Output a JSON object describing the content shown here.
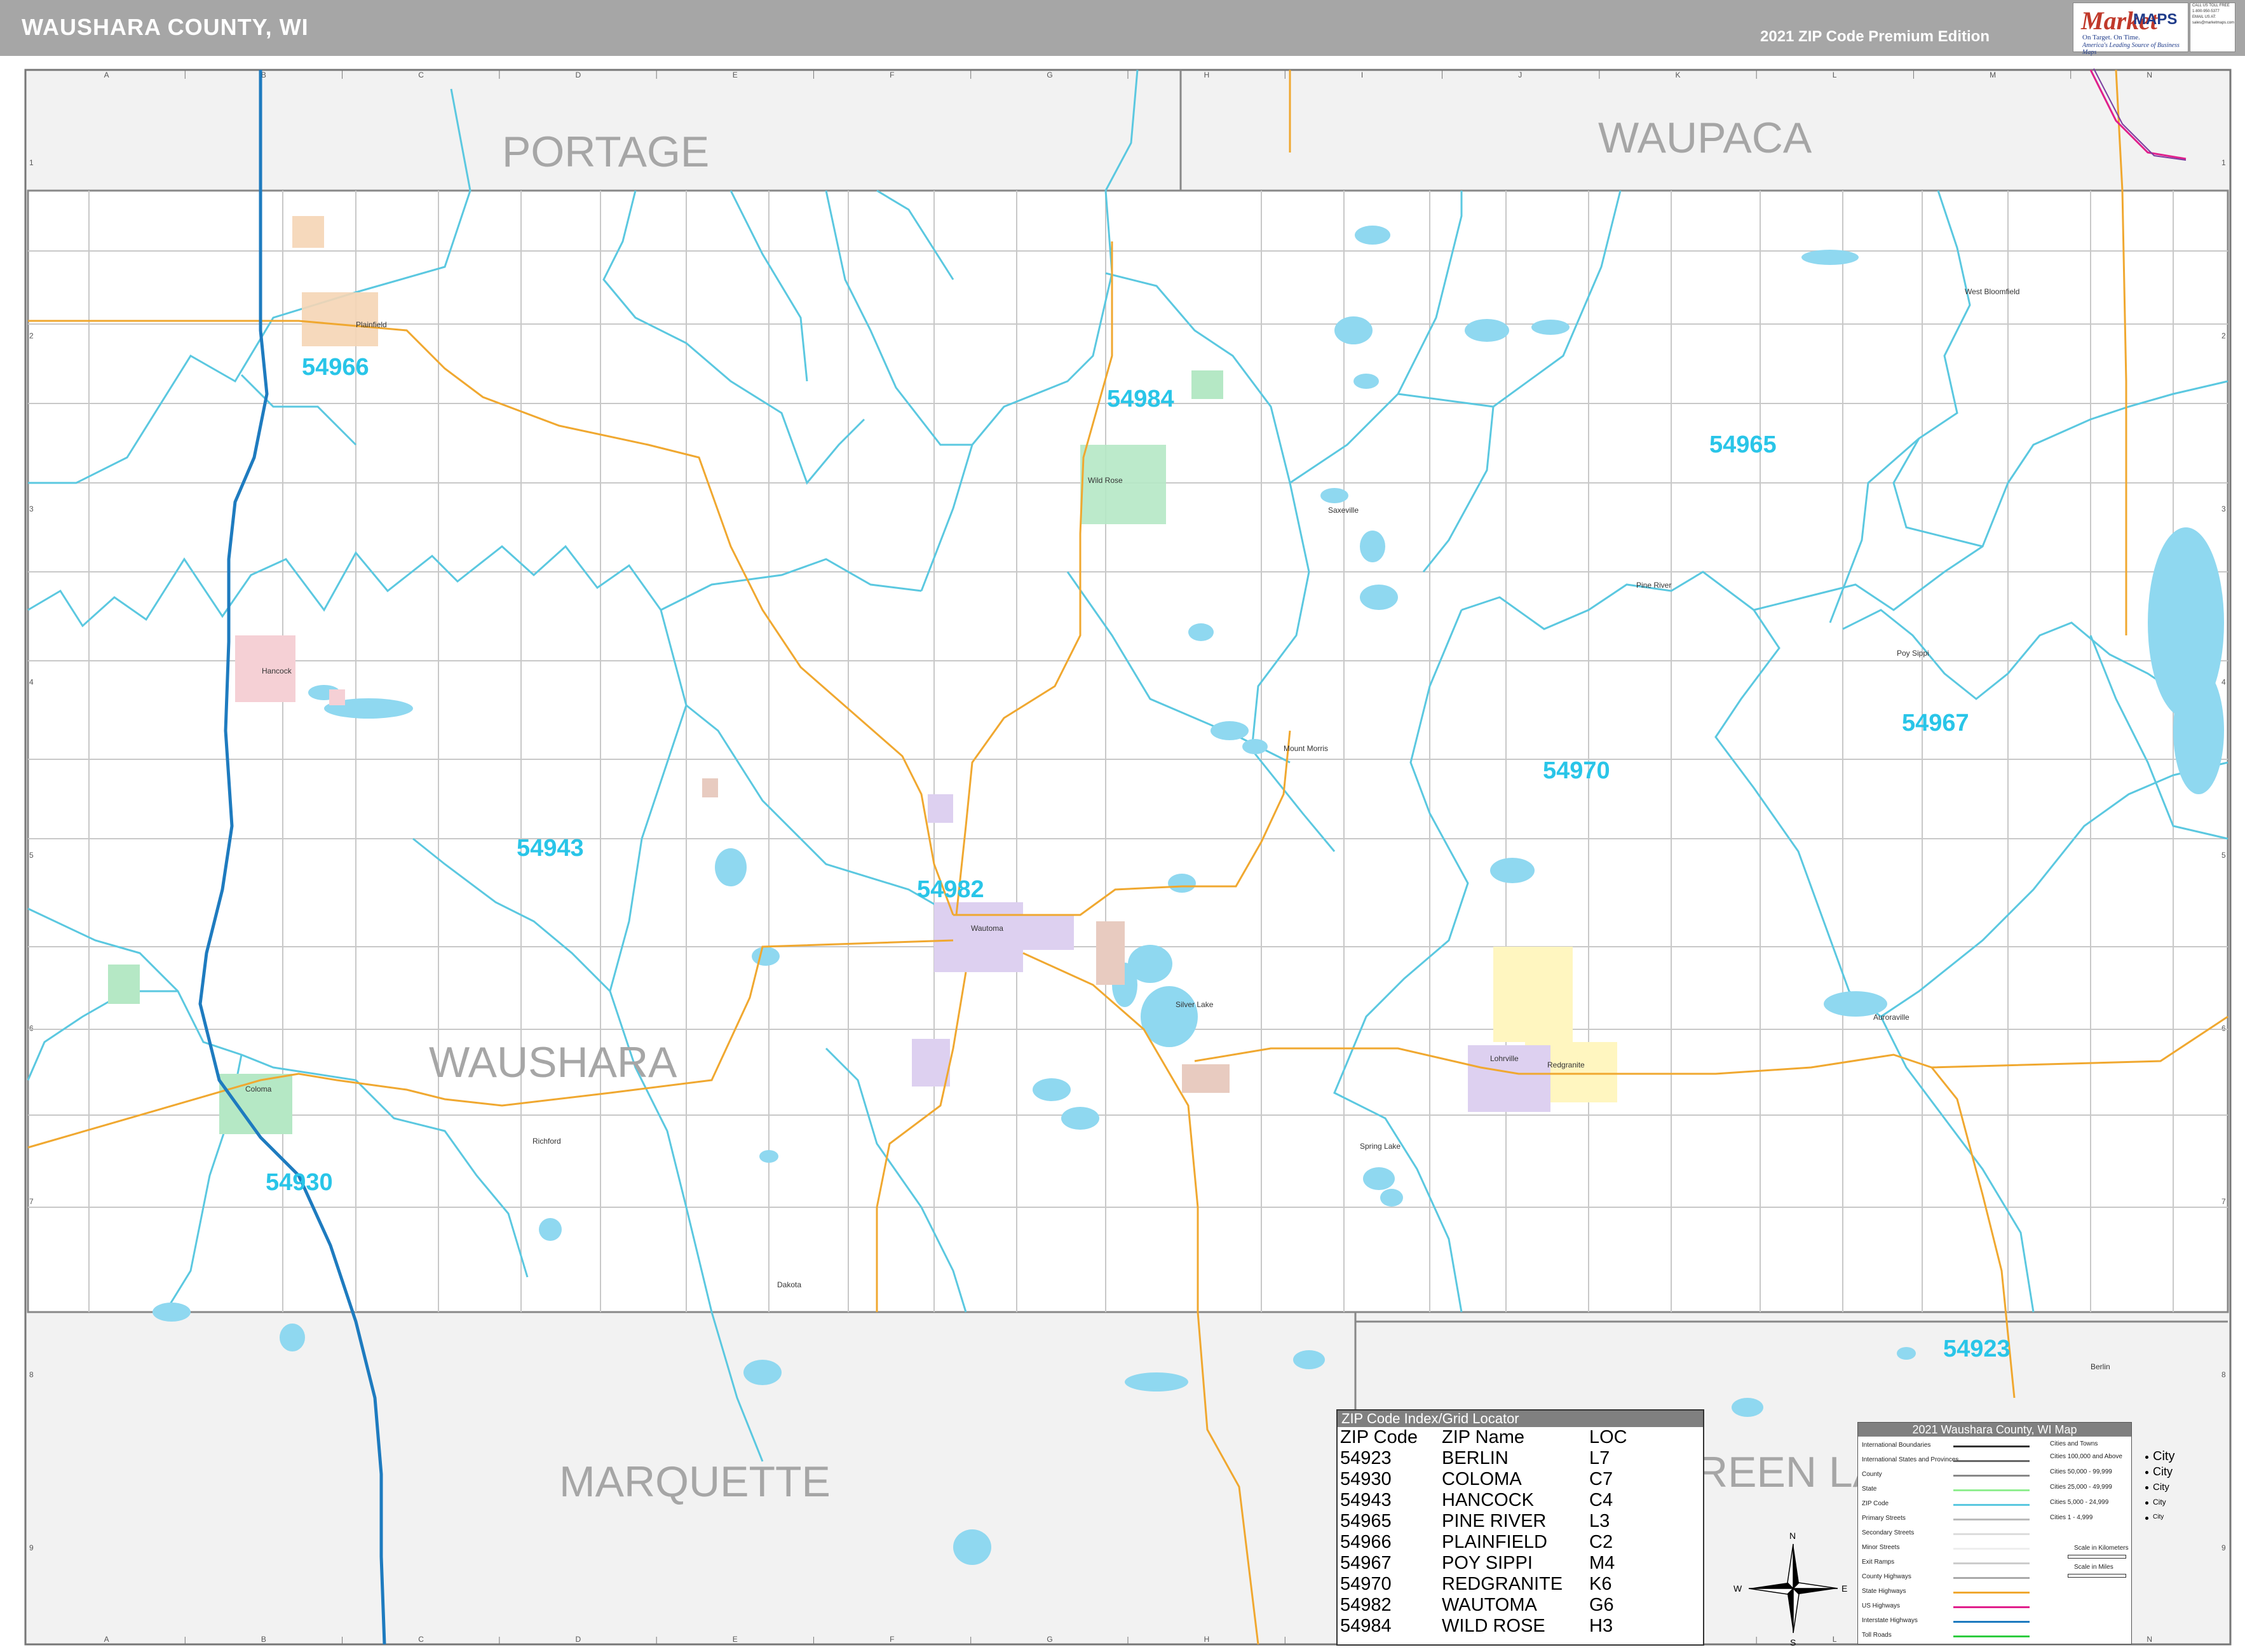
{
  "header": {
    "title": "WAUSHARA COUNTY, WI",
    "edition": "2021 ZIP Code Premium Edition"
  },
  "logo": {
    "brand": "Market",
    "maps": "MAPS",
    "tagline": "On Target.  On Time.",
    "subtag": "America's Leading Source of Business Maps"
  },
  "contact": [
    "CALL US TOLL FREE",
    "1-800-950-5377",
    "EMAIL US AT:",
    "sales@marketmaps.com"
  ],
  "grid": {
    "columns": [
      "A",
      "B",
      "C",
      "D",
      "E",
      "F",
      "G",
      "H",
      "I",
      "J",
      "K",
      "L",
      "M",
      "N"
    ],
    "rows": [
      "1",
      "2",
      "3",
      "4",
      "5",
      "6",
      "7",
      "8",
      "9"
    ]
  },
  "counties": {
    "portage": "PORTAGE",
    "waupaca": "WAUPACA",
    "waushara": "WAUSHARA",
    "marquette": "MARQUETTE",
    "green_lake": "REEN LA"
  },
  "zip_labels": {
    "z54966": "54966",
    "z54984": "54984",
    "z54965": "54965",
    "z54967": "54967",
    "z54970": "54970",
    "z54943": "54943",
    "z54982": "54982",
    "z54930": "54930",
    "z54923": "54923"
  },
  "places": {
    "plainfield": "Plainfield",
    "hancock": "Hancock",
    "wild_rose": "Wild Rose",
    "wautoma": "Wautoma",
    "coloma": "Coloma",
    "redgranite": "Redgranite",
    "lohrville": "Lohrville",
    "pine_river": "Pine River",
    "poy_sippi": "Poy Sippi",
    "mount_morris": "Mount Morris",
    "silver_lake": "Silver Lake",
    "spring_lake": "Spring Lake",
    "richford": "Richford",
    "auroraville": "Auroraville",
    "west_bloomfield": "West Bloomfield",
    "saxeville": "Saxeville",
    "dakota": "Dakota",
    "berlin": "Berlin"
  },
  "index": {
    "title": "ZIP Code Index/Grid Locator",
    "headers": [
      "ZIP Code",
      "ZIP Name",
      "LOC"
    ],
    "rows": [
      [
        "54923",
        "BERLIN",
        "L7"
      ],
      [
        "54930",
        "COLOMA",
        "C7"
      ],
      [
        "54943",
        "HANCOCK",
        "C4"
      ],
      [
        "54965",
        "PINE RIVER",
        "L3"
      ],
      [
        "54966",
        "PLAINFIELD",
        "C2"
      ],
      [
        "54967",
        "POY SIPPI",
        "M4"
      ],
      [
        "54970",
        "REDGRANITE",
        "K6"
      ],
      [
        "54982",
        "WAUTOMA",
        "G6"
      ],
      [
        "54984",
        "WILD ROSE",
        "H3"
      ]
    ]
  },
  "legend": {
    "title": "2021 Waushara County, WI Map",
    "cities_title": "Cities and Towns",
    "items": [
      {
        "label": "International Boundaries",
        "color": "#333333"
      },
      {
        "label": "International States and Provinces",
        "color": "#666666"
      },
      {
        "label": "County",
        "color": "#888888"
      },
      {
        "label": "State",
        "color": "#90ee90"
      },
      {
        "label": "ZIP Code",
        "color": "#5bc8e0"
      },
      {
        "label": "Primary Streets",
        "color": "#bbbbbb"
      },
      {
        "label": "Secondary Streets",
        "color": "#dddddd"
      },
      {
        "label": "Minor Streets",
        "color": "#eeeeee"
      },
      {
        "label": "Exit Ramps",
        "color": "#cccccc"
      },
      {
        "label": "County Highways",
        "color": "#aaaaaa"
      },
      {
        "label": "State Highways",
        "color": "#f0a830"
      },
      {
        "label": "US Highways",
        "color": "#e0208c"
      },
      {
        "label": "Interstate Highways",
        "color": "#1e7bbf"
      },
      {
        "label": "Toll Roads",
        "color": "#2ecc40"
      }
    ],
    "city_classes": [
      {
        "label": "Cities 100,000 and Above",
        "sample": "City"
      },
      {
        "label": "Cities 50,000 - 99,999",
        "sample": "City"
      },
      {
        "label": "Cities 25,000 - 49,999",
        "sample": "City"
      },
      {
        "label": "Cities 5,000 - 24,999",
        "sample": "City"
      },
      {
        "label": "Cities 1 - 4,999",
        "sample": "City"
      }
    ],
    "scale_km": "Scale in Kilometers",
    "scale_mi": "Scale in Miles"
  },
  "compass": {
    "n": "N",
    "s": "S",
    "e": "E",
    "w": "W"
  },
  "colors": {
    "zip_text": "#29c5e8",
    "zip_line": "#5bc8e0",
    "highway_state": "#f0a830",
    "interstate": "#1e7bbf",
    "water": "#8fd8f0",
    "outside_county": "#f0f0f0",
    "county_label": "#a6a6a6"
  }
}
